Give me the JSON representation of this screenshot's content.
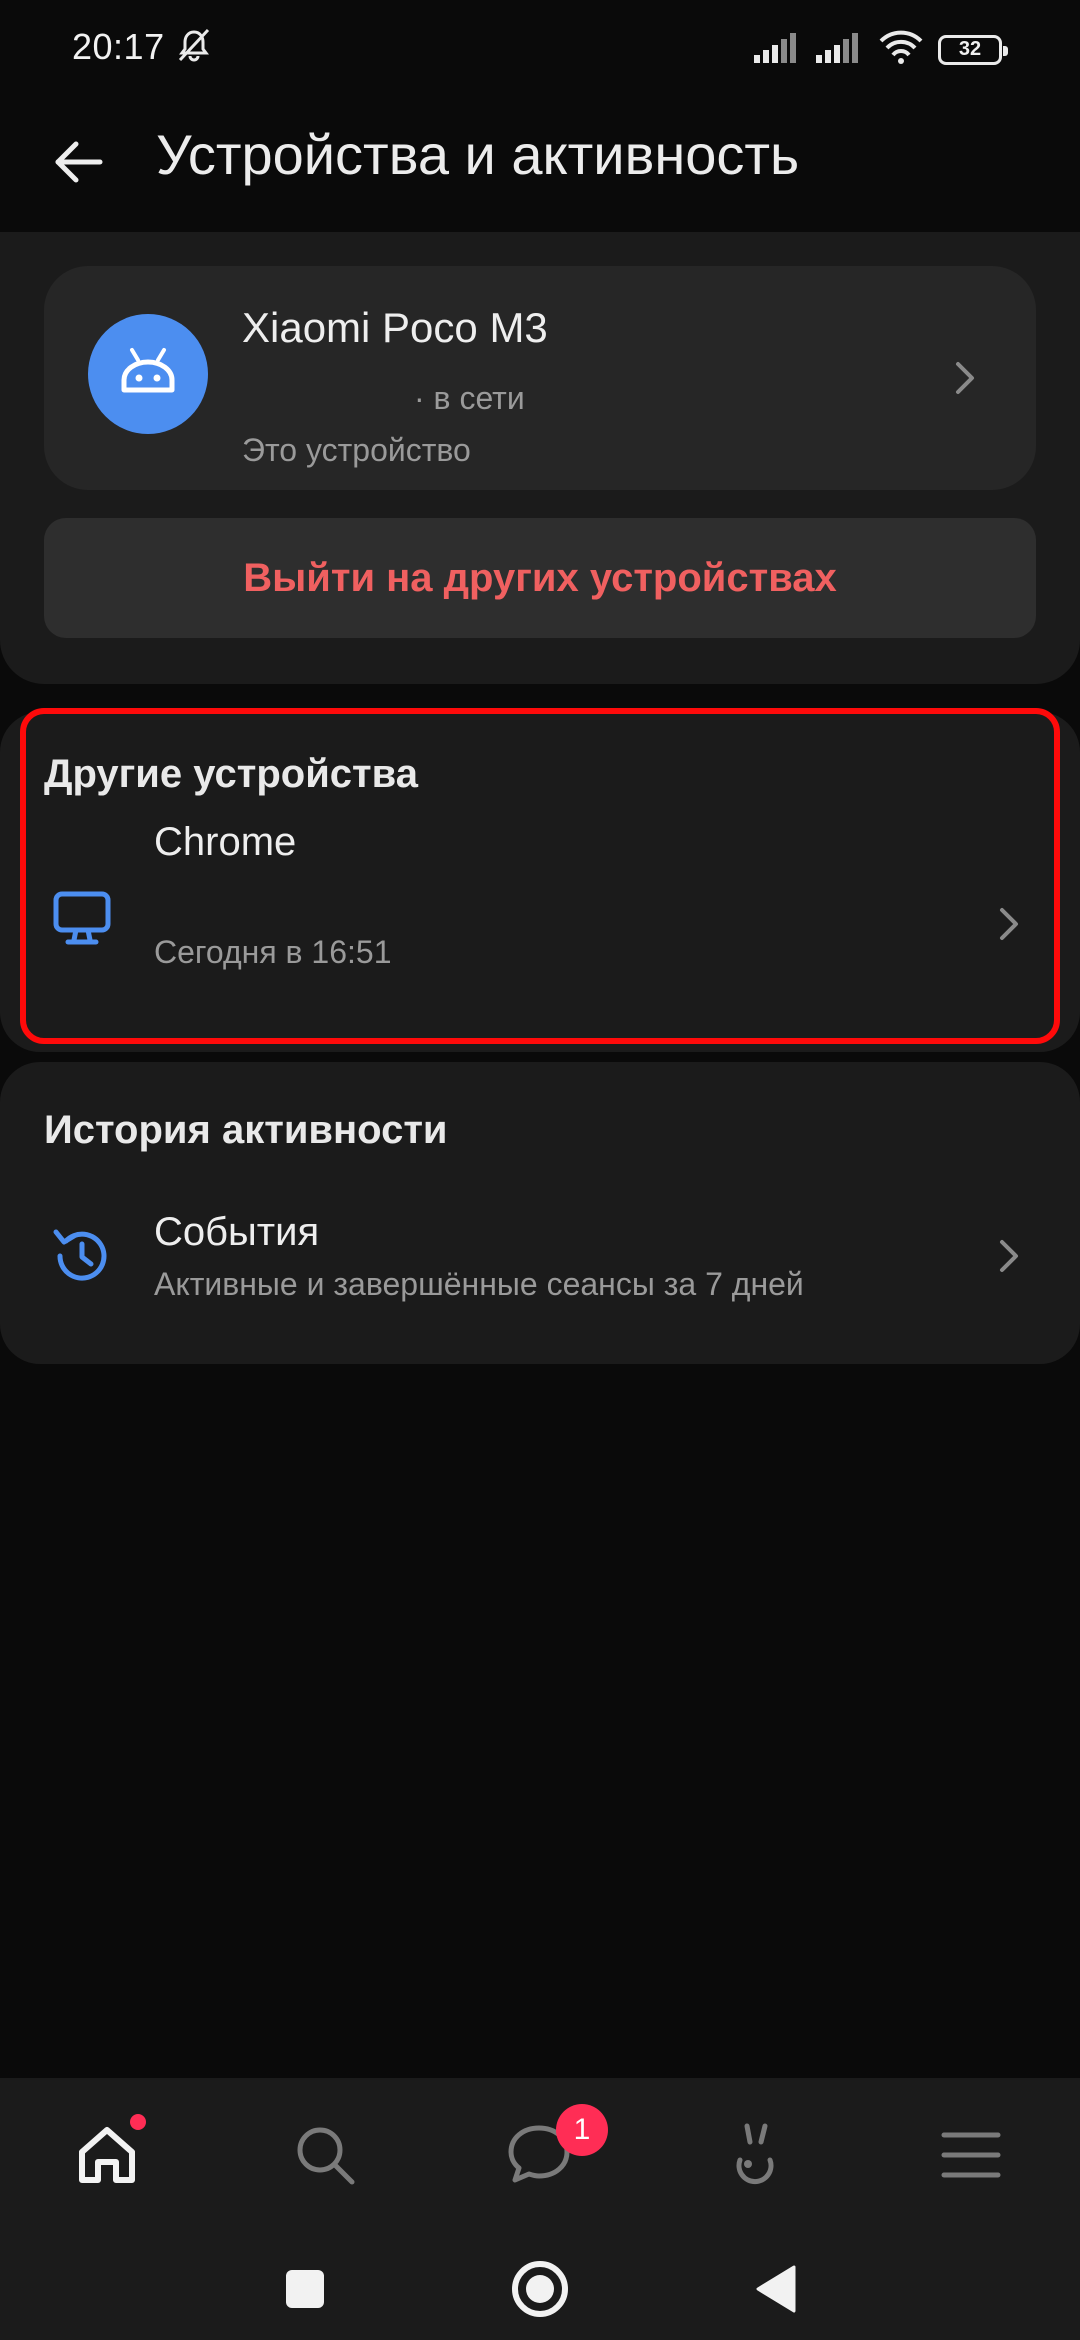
{
  "status_bar": {
    "time": "20:17",
    "battery": "32",
    "icons": [
      "mute-bell-icon",
      "signal-icon",
      "signal-icon",
      "wifi-icon",
      "battery-icon"
    ]
  },
  "header": {
    "title": "Устройства и активность",
    "back_icon": "arrow-left-icon"
  },
  "current_device": {
    "name": "Xiaomi Poco M3",
    "status": "· в сети",
    "subtitle": "Это устройство",
    "icon": "android-icon"
  },
  "logout_button": {
    "label": "Выйти на других устройствах"
  },
  "other_devices": {
    "title": "Другие устройства",
    "items": [
      {
        "name": "Chrome",
        "time": "Сегодня в 16:51",
        "icon": "monitor-icon"
      }
    ]
  },
  "activity_history": {
    "title": "История активности",
    "items": [
      {
        "title": "События",
        "subtitle": "Активные и завершённые сеансы за 7 дней",
        "icon": "history-icon"
      }
    ]
  },
  "bottom_nav": {
    "items": [
      "home-icon",
      "search-icon",
      "messages-icon",
      "clips-icon",
      "menu-icon"
    ],
    "messages_badge": "1"
  },
  "colors": {
    "accent": "#4c8ef0",
    "danger": "#f06060",
    "badge": "#ff2d55",
    "highlight": "#ff0a0a"
  }
}
